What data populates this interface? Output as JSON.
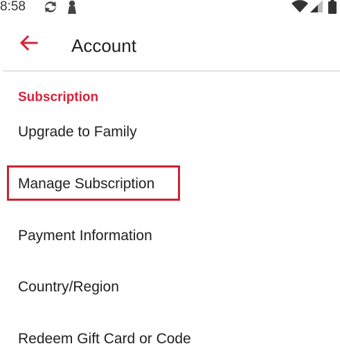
{
  "status_bar": {
    "time": "8:58",
    "icons": [
      "sync-icon",
      "person-icon",
      "wifi-icon",
      "signal-icon",
      "battery-icon"
    ]
  },
  "app_bar": {
    "back_icon": "arrow-left-icon",
    "title": "Account"
  },
  "colors": {
    "accent": "#d6223a",
    "highlight": "#cc2232",
    "text": "#212121",
    "divider": "#c8c8c8"
  },
  "section": {
    "header": "Subscription"
  },
  "items": [
    {
      "label": "Upgrade to Family"
    },
    {
      "label": "Manage Subscription",
      "highlighted": true
    },
    {
      "label": "Payment Information"
    },
    {
      "label": "Country/Region"
    },
    {
      "label": "Redeem Gift Card or Code"
    }
  ]
}
